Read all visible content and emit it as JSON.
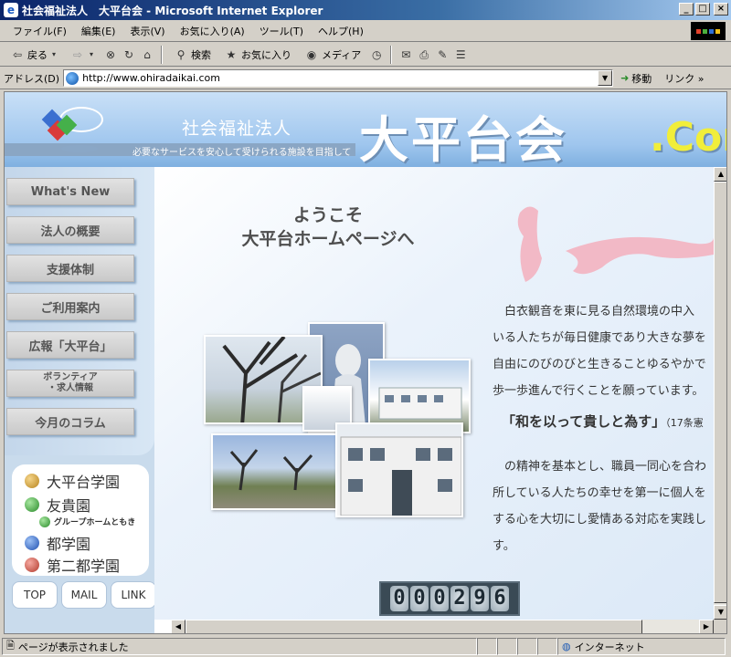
{
  "window": {
    "title": "社会福祉法人　大平台会 - Microsoft Internet Explorer",
    "minimize": "_",
    "maximize": "□",
    "close": "×"
  },
  "menu": [
    "ファイル(F)",
    "編集(E)",
    "表示(V)",
    "お気に入り(A)",
    "ツール(T)",
    "ヘルプ(H)"
  ],
  "toolbar": {
    "back": "戻る",
    "search": "検索",
    "favorites": "お気に入り",
    "media": "メディア"
  },
  "address": {
    "label": "アドレス(D)",
    "url": "http://www.ohiradaikai.com",
    "go": "移動",
    "links": "リンク »"
  },
  "header": {
    "corp_label": "社会福祉法人",
    "site_name": "大平台会",
    "tld": ".Com",
    "tagline": "必要なサービスを安心して受けられる施設を目指して"
  },
  "nav": [
    "What's New",
    "法人の概要",
    "支援体制",
    "ご利用案内",
    "広報「大平台」",
    "ボランティア\n・求人情報",
    "今月のコラム"
  ],
  "facilities": {
    "f1": "大平台学園",
    "f2": "友貴園",
    "f2_sub": "グループホームともき",
    "f3": "都学園",
    "f4": "第二都学園"
  },
  "bottom_nav": {
    "top": "TOP",
    "mail": "MAIL",
    "link": "LINK"
  },
  "main": {
    "welcome_line1": "ようこそ",
    "welcome_line2": "大平台ホームページへ",
    "intro": [
      "　白衣観音を東に見る自然環境の中入",
      "いる人たちが毎日健康であり大きな夢を",
      "自由にのびのびと生きることゆるやかで",
      "歩一歩進んで行くことを願っています。"
    ],
    "motto": "「和を以って貴しと為す」",
    "motto_note": "（17条憲",
    "intro2": [
      "　の精神を基本とし、職員一同心を合わ",
      "所している人たちの幸せを第一に個人を",
      "する心を大切にし愛情ある対応を実践し",
      "す。"
    ],
    "counter": [
      "0",
      "0",
      "0",
      "2",
      "9",
      "6"
    ]
  },
  "status": {
    "message": "ページが表示されました",
    "zone": "インターネット"
  },
  "colors": {
    "header_bg": "#9fc6ee",
    "tld_yellow": "#f1ee3a",
    "calligraphy": "#f2b9c6"
  }
}
